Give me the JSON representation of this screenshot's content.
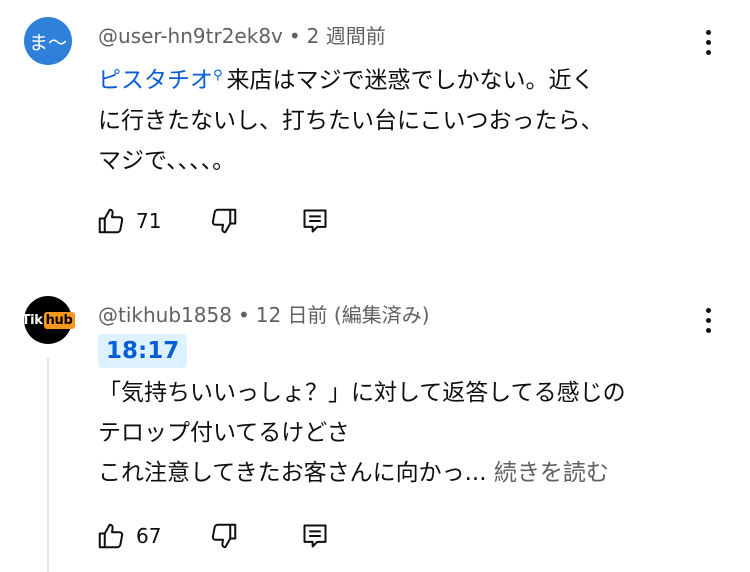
{
  "comments": [
    {
      "avatar_text": "ま〜",
      "avatar_color": "#2f80d8",
      "author": "@user-hn9tr2ek8v",
      "time": "2 週間前",
      "hashtag": "ピスタチオ",
      "text_after_tag": "来店はマジで迷惑でしかない。近く\nに行きたないし、打ちたい台にこいつおったら、\nマジで、、、、。",
      "likes": "71"
    },
    {
      "avatar_text": "Tik",
      "avatar_badge": "hub",
      "author": "@tikhub1858",
      "time": "12 日前 (編集済み)",
      "timestamp_link": "18:17",
      "text": "「気持ちいいっしょ？」に対して返答してる感じの\nテロップ付いてるけどさ\nこれ注意してきたお客さんに向かっ... ",
      "read_more": "続きを読む",
      "likes": "67"
    }
  ],
  "colors": {
    "link": "#065fd4",
    "meta": "#606060",
    "timestamp_bg": "#def1ff"
  },
  "icons": [
    "like-icon",
    "dislike-icon",
    "reply-icon",
    "more-options-icon"
  ]
}
